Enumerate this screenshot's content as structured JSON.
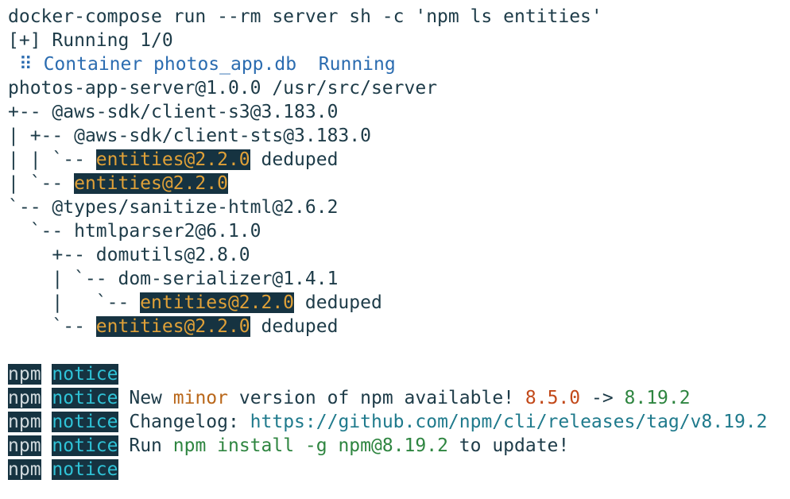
{
  "terminal": {
    "command": "docker-compose run --rm server sh -c 'npm ls entities'",
    "running": "[+] Running 1/0",
    "container_icon": "⠿",
    "container_name": "Container photos_app.db",
    "container_status": "Running",
    "root_package": "photos-app-server@1.0.0 /usr/src/server",
    "tree": [
      {
        "prefix": "+-- ",
        "pkg": "@aws-sdk/client-s3@3.183.0",
        "hl": "",
        "suffix": ""
      },
      {
        "prefix": "| +-- ",
        "pkg": "@aws-sdk/client-sts@3.183.0",
        "hl": "",
        "suffix": ""
      },
      {
        "prefix": "| | `-- ",
        "pkg": "",
        "hl": "entities@2.2.0",
        "suffix": " deduped"
      },
      {
        "prefix": "| `-- ",
        "pkg": "",
        "hl": "entities@2.2.0",
        "suffix": ""
      },
      {
        "prefix": "`-- ",
        "pkg": "@types/sanitize-html@2.6.2",
        "hl": "",
        "suffix": ""
      },
      {
        "prefix": "  `-- ",
        "pkg": "htmlparser2@6.1.0",
        "hl": "",
        "suffix": ""
      },
      {
        "prefix": "    +-- ",
        "pkg": "domutils@2.8.0",
        "hl": "",
        "suffix": ""
      },
      {
        "prefix": "    | `-- ",
        "pkg": "dom-serializer@1.4.1",
        "hl": "",
        "suffix": ""
      },
      {
        "prefix": "    |   `-- ",
        "pkg": "",
        "hl": "entities@2.2.0",
        "suffix": " deduped"
      },
      {
        "prefix": "    `-- ",
        "pkg": "",
        "hl": "entities@2.2.0",
        "suffix": " deduped"
      }
    ],
    "npm_label": "npm",
    "notice_label": "notice",
    "notice_new_text": " New ",
    "notice_minor": "minor",
    "notice_version_text": " version of npm available! ",
    "notice_old_version": "8.5.0",
    "notice_arrow": " -> ",
    "notice_new_version": "8.19.2",
    "notice_changelog_label": " Changelog: ",
    "notice_changelog_url": "https://github.com/npm/cli/releases/tag/v8.19.2",
    "notice_run_label": " Run ",
    "notice_run_cmd": "npm install -g npm@8.19.2",
    "notice_run_suffix": " to update!"
  }
}
